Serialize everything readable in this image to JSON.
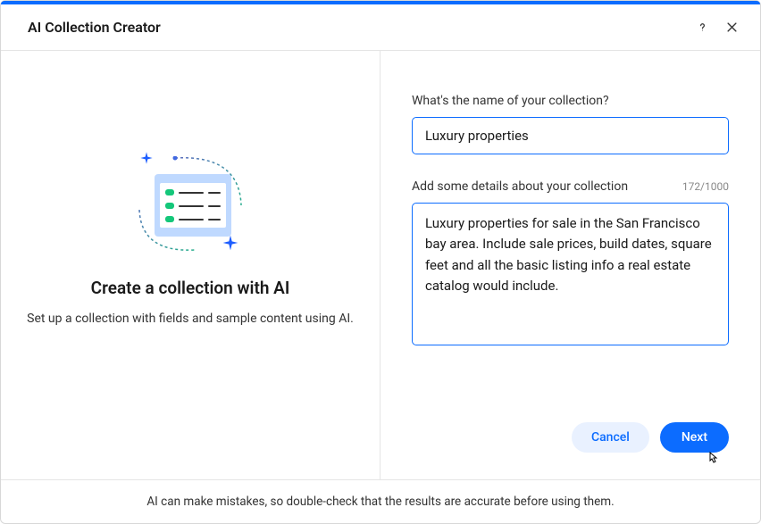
{
  "header": {
    "title": "AI Collection Creator"
  },
  "left": {
    "title": "Create a collection with AI",
    "subtitle": "Set up a collection with fields and sample content using AI."
  },
  "form": {
    "name_label": "What's the name of your collection?",
    "name_value": "Luxury properties",
    "details_label": "Add some details about your collection",
    "details_value": "Luxury properties for sale in the San Francisco bay area. Include sale prices, build dates, square feet and all the basic listing info a real estate catalog would include.",
    "char_count": "172/1000"
  },
  "buttons": {
    "cancel": "Cancel",
    "next": "Next"
  },
  "footer": {
    "disclaimer": "AI can make mistakes, so double-check that the results are accurate before using them."
  }
}
